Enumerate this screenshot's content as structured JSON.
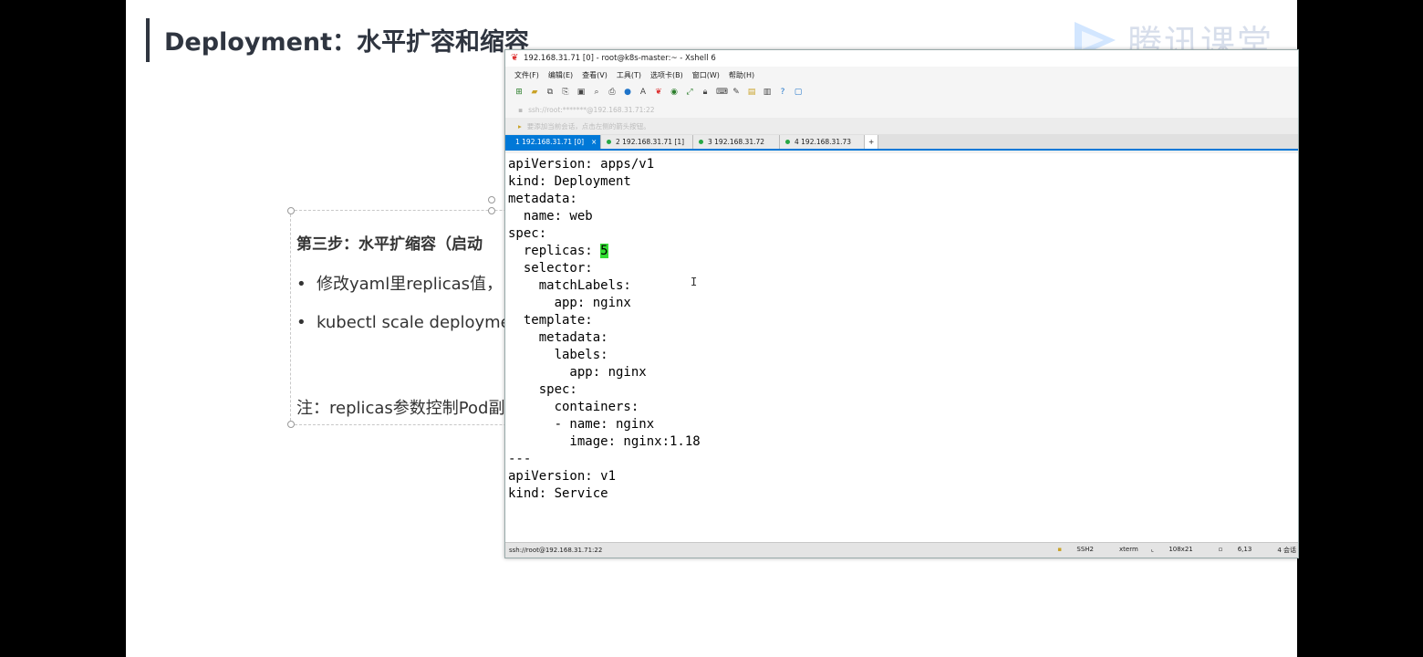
{
  "slide": {
    "title": "Deployment：水平扩容和缩容",
    "logo_text": "腾讯课堂"
  },
  "textbox": {
    "step": "第三步：水平扩缩容（启动",
    "bullet1": "修改yaml里replicas值，",
    "bullet2": "kubectl scale deployme",
    "note": "注：replicas参数控制Pod副"
  },
  "xshell": {
    "title": "192.168.31.71 [0] - root@k8s-master:~ - Xshell 6",
    "menu": [
      "文件(F)",
      "编辑(E)",
      "查看(V)",
      "工具(T)",
      "选项卡(B)",
      "窗口(W)",
      "帮助(H)"
    ],
    "address": "ssh://root:*******@192.168.31.71:22",
    "hint": "要添加当前会话，点击左侧的箭头按钮。",
    "tabs": [
      {
        "label": "1 192.168.31.71 [0]",
        "active": true
      },
      {
        "label": "2 192.168.31.71 [1]",
        "active": false
      },
      {
        "label": "3 192.168.31.72",
        "active": false
      },
      {
        "label": "4 192.168.31.73",
        "active": false
      }
    ],
    "terminal_lines": [
      "apiVersion: apps/v1",
      "kind: Deployment",
      "metadata:",
      "  name: web",
      "spec:",
      "  replicas: ",
      "  selector:",
      "    matchLabels:",
      "      app: nginx",
      "  template:",
      "    metadata:",
      "      labels:",
      "        app: nginx",
      "    spec:",
      "      containers:",
      "      - name: nginx",
      "        image: nginx:1.18",
      "---",
      "apiVersion: v1",
      "kind: Service"
    ],
    "replicas_value": "5",
    "status": {
      "connection": "ssh://root@192.168.31.71:22",
      "protocol": "SSH2",
      "term": "xterm",
      "size": "108x21",
      "position": "6,13",
      "sessions": "4 会话"
    },
    "colors": {
      "accent": "#0078d7",
      "highlight": "#33dd33",
      "online": "#28a745"
    }
  }
}
